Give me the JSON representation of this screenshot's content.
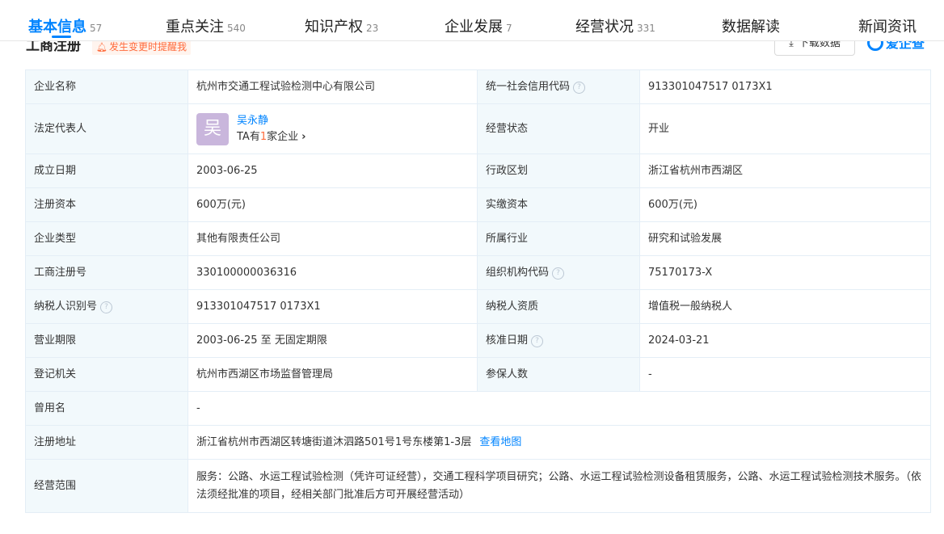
{
  "tabs": [
    {
      "label": "基本信息",
      "count": "57"
    },
    {
      "label": "重点关注",
      "count": "540"
    },
    {
      "label": "知识产权",
      "count": "23"
    },
    {
      "label": "企业发展",
      "count": "7"
    },
    {
      "label": "经营状况",
      "count": "331"
    },
    {
      "label": "数据解读",
      "count": ""
    },
    {
      "label": "新闻资讯",
      "count": ""
    }
  ],
  "section": {
    "title": "工商注册",
    "alert": "发生变更时提醒我",
    "download_label": "下载数据",
    "brand": "爱企查"
  },
  "rows": {
    "company_name": {
      "label": "企业名称",
      "value": "杭州市交通工程试验检测中心有限公司"
    },
    "credit_code": {
      "label": "统一社会信用代码",
      "value": "913301047517 0173X1"
    },
    "legal_rep": {
      "label": "法定代表人",
      "avatar": "吴",
      "name": "吴永静",
      "sub_prefix": "TA有",
      "sub_count": "1",
      "sub_suffix": "家企业"
    },
    "status": {
      "label": "经营状态",
      "value": "开业"
    },
    "established": {
      "label": "成立日期",
      "value": "2003-06-25"
    },
    "region": {
      "label": "行政区划",
      "value": "浙江省杭州市西湖区"
    },
    "reg_capital": {
      "label": "注册资本",
      "value": "600万(元)"
    },
    "paid_capital": {
      "label": "实缴资本",
      "value": "600万(元)"
    },
    "company_type": {
      "label": "企业类型",
      "value": "其他有限责任公司"
    },
    "industry": {
      "label": "所属行业",
      "value": "研究和试验发展"
    },
    "reg_number": {
      "label": "工商注册号",
      "value": "330100000036316"
    },
    "org_code": {
      "label": "组织机构代码",
      "value": "75170173-X"
    },
    "taxpayer_id": {
      "label": "纳税人识别号",
      "value": "913301047517 0173X1"
    },
    "taxpayer_qual": {
      "label": "纳税人资质",
      "value": "增值税一般纳税人"
    },
    "business_term": {
      "label": "营业期限",
      "value": "2003-06-25 至 无固定期限"
    },
    "approval_date": {
      "label": "核准日期",
      "value": "2024-03-21"
    },
    "authority": {
      "label": "登记机关",
      "value": "杭州市西湖区市场监督管理局"
    },
    "insured": {
      "label": "参保人数",
      "value": "-"
    },
    "former_name": {
      "label": "曾用名",
      "value": "-"
    },
    "address": {
      "label": "注册地址",
      "value": "浙江省杭州市西湖区转塘街道沐泗路501号1号东楼第1-3层",
      "map_link": "查看地图"
    },
    "scope": {
      "label": "经营范围",
      "value": "服务：公路、水运工程试验检测（凭许可证经营），交通工程科学项目研究；公路、水运工程试验检测设备租赁服务，公路、水运工程试验检测技术服务。（依法须经批准的项目，经相关部门批准后方可开展经营活动）"
    }
  }
}
